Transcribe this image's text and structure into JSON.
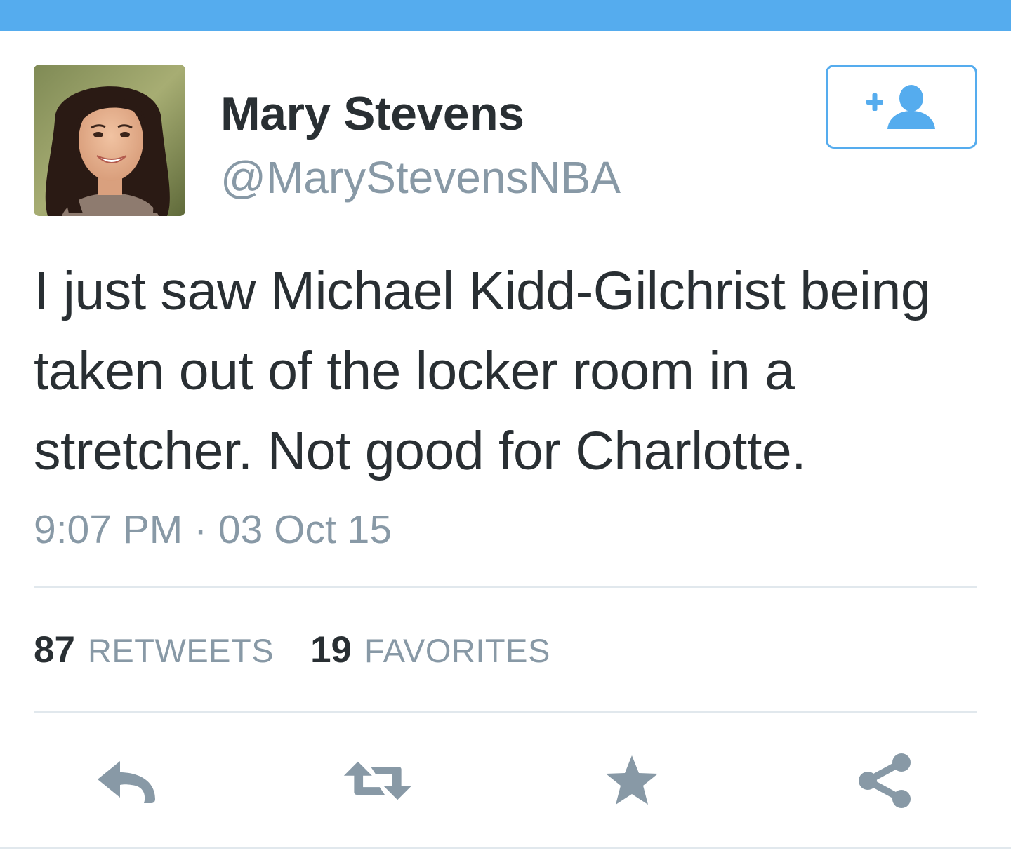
{
  "user": {
    "display_name": "Mary Stevens",
    "screen_name": "@MaryStevensNBA",
    "avatar": "profile-photo"
  },
  "follow_button": {
    "icon": "add-user-icon"
  },
  "tweet": {
    "text": "I just saw Michael Kidd-Gilchrist being taken out of the locker room in a stretcher. Not good for Charlotte.",
    "timestamp": "9:07 PM · 03 Oct 15"
  },
  "stats": {
    "retweets_count": "87",
    "retweets_label": "RETWEETS",
    "favorites_count": "19",
    "favorites_label": "FAVORITES"
  },
  "actions": [
    {
      "name": "reply",
      "icon": "reply-icon"
    },
    {
      "name": "retweet",
      "icon": "retweet-icon"
    },
    {
      "name": "favorite",
      "icon": "star-icon"
    },
    {
      "name": "share",
      "icon": "share-icon"
    }
  ],
  "colors": {
    "brand": "#55acee",
    "text": "#292f33",
    "muted": "#8899a6",
    "icon": "#8899a6",
    "divider": "#e1e8ed"
  }
}
